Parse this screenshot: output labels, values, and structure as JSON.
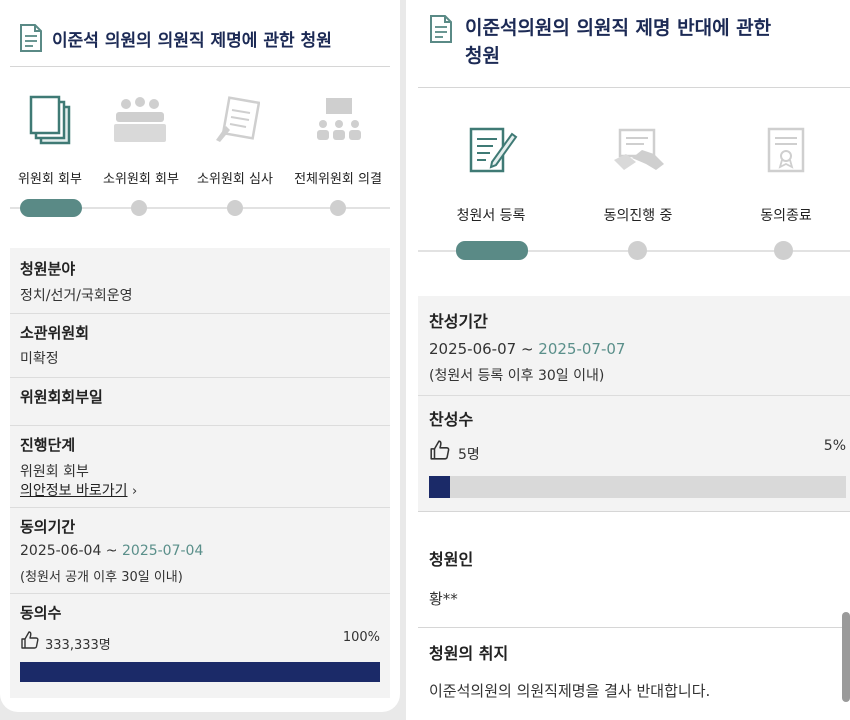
{
  "left": {
    "title": "이준석 의원의 의원직 제명에 관한 청원",
    "steps": [
      {
        "label": "위원회 회부",
        "active": true
      },
      {
        "label": "소위원회 회부",
        "active": false
      },
      {
        "label": "소위원회 심사",
        "active": false
      },
      {
        "label": "전체위원회 의결",
        "active": false
      }
    ],
    "field_label": "청원분야",
    "field_value": "정치/선거/국회운영",
    "committee_label": "소관위원회",
    "committee_value": "미확정",
    "referral_label": "위원회회부일",
    "stage_label": "진행단계",
    "stage_value": "위원회 회부",
    "stage_link": "의안정보 바로가기",
    "period_label": "동의기간",
    "period_start": "2025-06-04 ~ ",
    "period_end": "2025-07-04",
    "period_note": "(청원서 공개 이후 30일 이내)",
    "count_label": "동의수",
    "count_value": "333,333명",
    "percent_text": "100%",
    "progress": 1.0
  },
  "right": {
    "title_line1": "이준석의원의 의원직 제명 반대에 관한",
    "title_line2": "청원",
    "steps": [
      {
        "label": "청원서 등록",
        "active": true
      },
      {
        "label": "동의진행 중",
        "active": false
      },
      {
        "label": "동의종료",
        "active": false
      }
    ],
    "period_label": "찬성기간",
    "period_start": "2025-06-07 ~ ",
    "period_end": "2025-07-07",
    "period_note": "(청원서 등록 이후 30일 이내)",
    "count_label": "찬성수",
    "count_value": "5명",
    "percent_text": "5%",
    "progress": 0.05,
    "petitioner_label": "청원인",
    "petitioner_value": "황**",
    "purpose_label": "청원의 취지",
    "purpose_value": "이준석의원의 의원직제명을 결사 반대합니다."
  },
  "colors": {
    "title": "#1c2a55",
    "teal": "#5a8a86",
    "link_date": "#5a8f8a",
    "progress_fill": "#1b2a68",
    "progress_bg": "#d9d9d9"
  },
  "icons": [
    "document-icon",
    "documents-icon",
    "meeting-icon",
    "review-icon",
    "presentation-icon",
    "pen-document-icon",
    "handshake-document-icon",
    "certificate-icon",
    "thumbs-up-icon",
    "chevron-right-icon"
  ]
}
